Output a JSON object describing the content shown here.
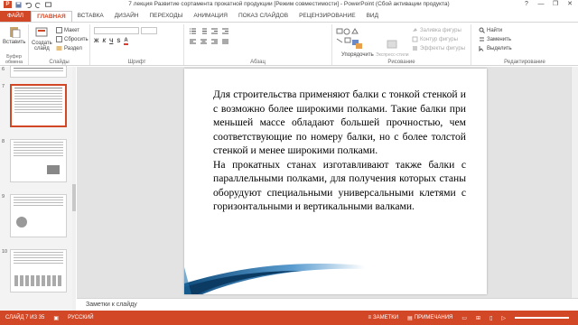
{
  "window": {
    "title": "7 лекция Развитие сортамента прокатной продукции [Режим совместимости] - PowerPoint (Сбой активации продукта)",
    "logo_letter": "P",
    "minimize": "—",
    "restore": "❐",
    "close": "✕",
    "help": "?"
  },
  "tabs": [
    "ФАЙЛ",
    "ГЛАВНАЯ",
    "ВСТАВКА",
    "ДИЗАЙН",
    "ПЕРЕХОДЫ",
    "АНИМАЦИЯ",
    "ПОКАЗ СЛАЙДОВ",
    "РЕЦЕНЗИРОВАНИЕ",
    "ВИД"
  ],
  "ribbon": {
    "paste": "Вставить",
    "create_slide": "Создать\nслайд",
    "layout": "Макет",
    "reset": "Сбросить",
    "section": "Раздел",
    "groups": {
      "clipboard": "Буфер обмена",
      "slides": "Слайды",
      "font": "Шрифт",
      "paragraph": "Абзац",
      "drawing": "Рисование",
      "editing": "Редактирование"
    },
    "arrange": "Упорядочить",
    "quick_styles": "Экспресс-стили",
    "shape_fill": "Заливка фигуры",
    "shape_outline": "Контур фигуры",
    "shape_effects": "Эффекты фигуры",
    "find": "Найти",
    "replace": "Заменить",
    "select": "Выделить"
  },
  "thumbnails": [
    {
      "num": "6",
      "selected": false
    },
    {
      "num": "7",
      "selected": true
    },
    {
      "num": "8",
      "selected": false
    },
    {
      "num": "9",
      "selected": false
    },
    {
      "num": "10",
      "selected": false
    }
  ],
  "slide": {
    "paragraph1": "Для строительства применяют балки с тонкой стенкой и с возможно более широкими полками. Такие балки при меньшей массе обладают большей прочностью, чем соответствующие по номеру балки, но с более толстой стенкой и менее широкими полками.",
    "paragraph2": "На прокатных станах изготавливают также балки с параллельными полками, для получения которых станы оборудуют специальными универсальными клетями с горизонтальными и вертикальными валками."
  },
  "notes": {
    "placeholder": "Заметки к слайду"
  },
  "status": {
    "slide": "СЛАЙД 7 ИЗ 35",
    "language": "РУССКИЙ",
    "notes": "ЗАМЕТКИ",
    "comments": "ПРИМЕЧАНИЯ"
  },
  "colors": {
    "accent": "#d24726",
    "slide_bar": "#1f6fa8"
  }
}
